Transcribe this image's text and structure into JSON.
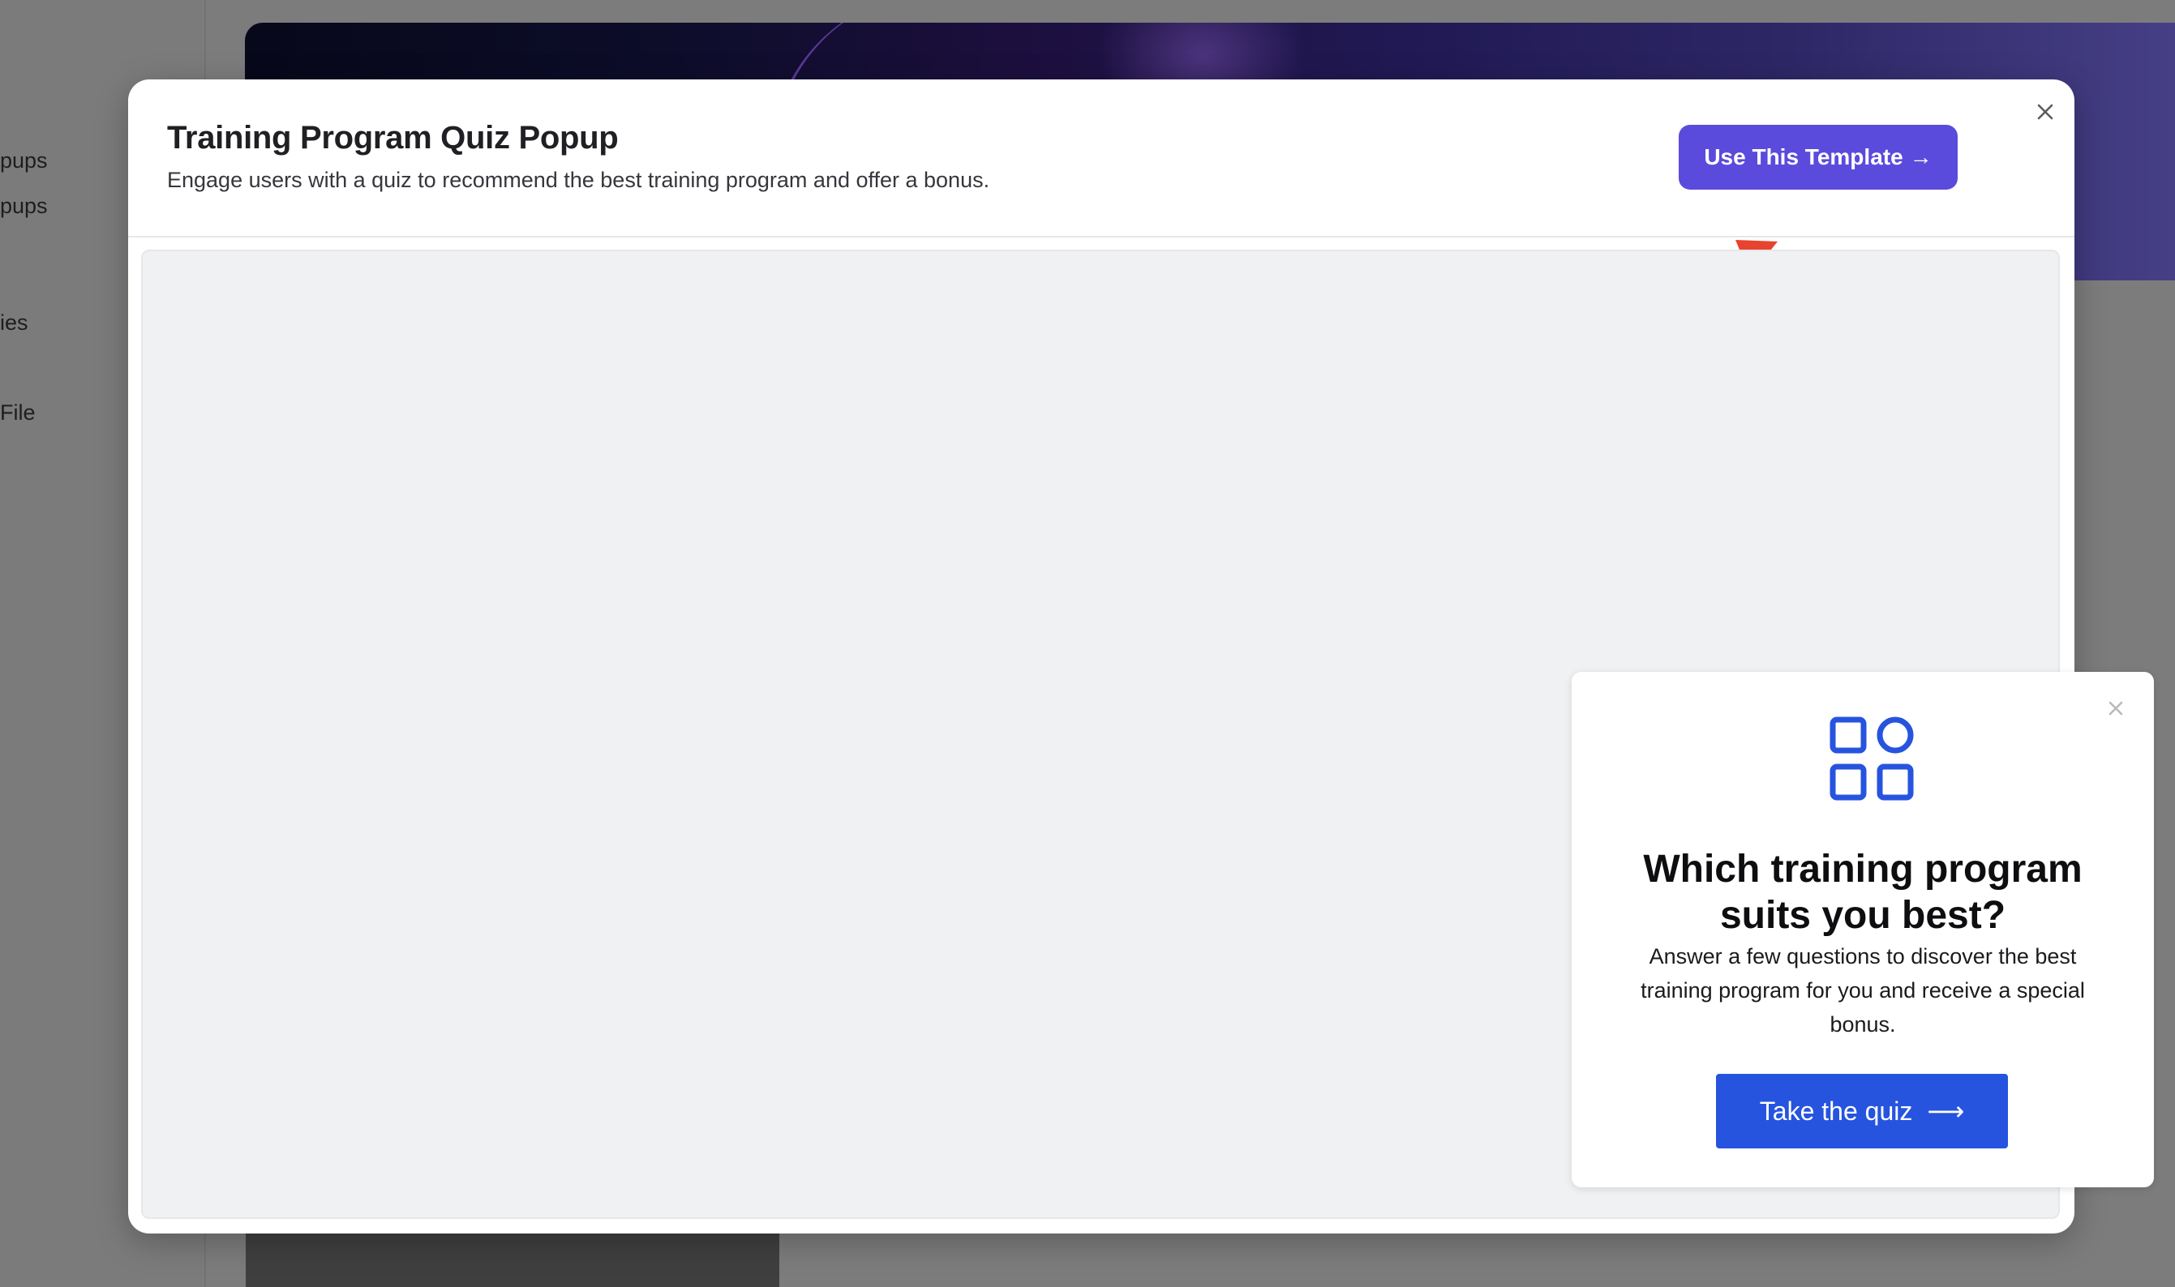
{
  "background": {
    "sidebar_items": [
      "pups",
      "pups",
      "ies",
      "File"
    ]
  },
  "modal": {
    "title": "Training Program Quiz Popup",
    "description": "Engage users with a quiz to recommend the best training program and offer a bonus.",
    "use_template_label": "Use This Template",
    "use_template_arrow": "→",
    "close_icon": "close-icon",
    "accent_color": "#5a4bdc",
    "annotation_color": "#e8432e"
  },
  "quiz_popup": {
    "icon": "grid-shapes-icon",
    "heading": "Which training program suits you best?",
    "text": "Answer a few questions to discover the best training program for you and receive a special bonus.",
    "cta_label": "Take the quiz",
    "cta_arrow": "⟶",
    "cta_color": "#2654df",
    "close_icon": "close-icon"
  }
}
